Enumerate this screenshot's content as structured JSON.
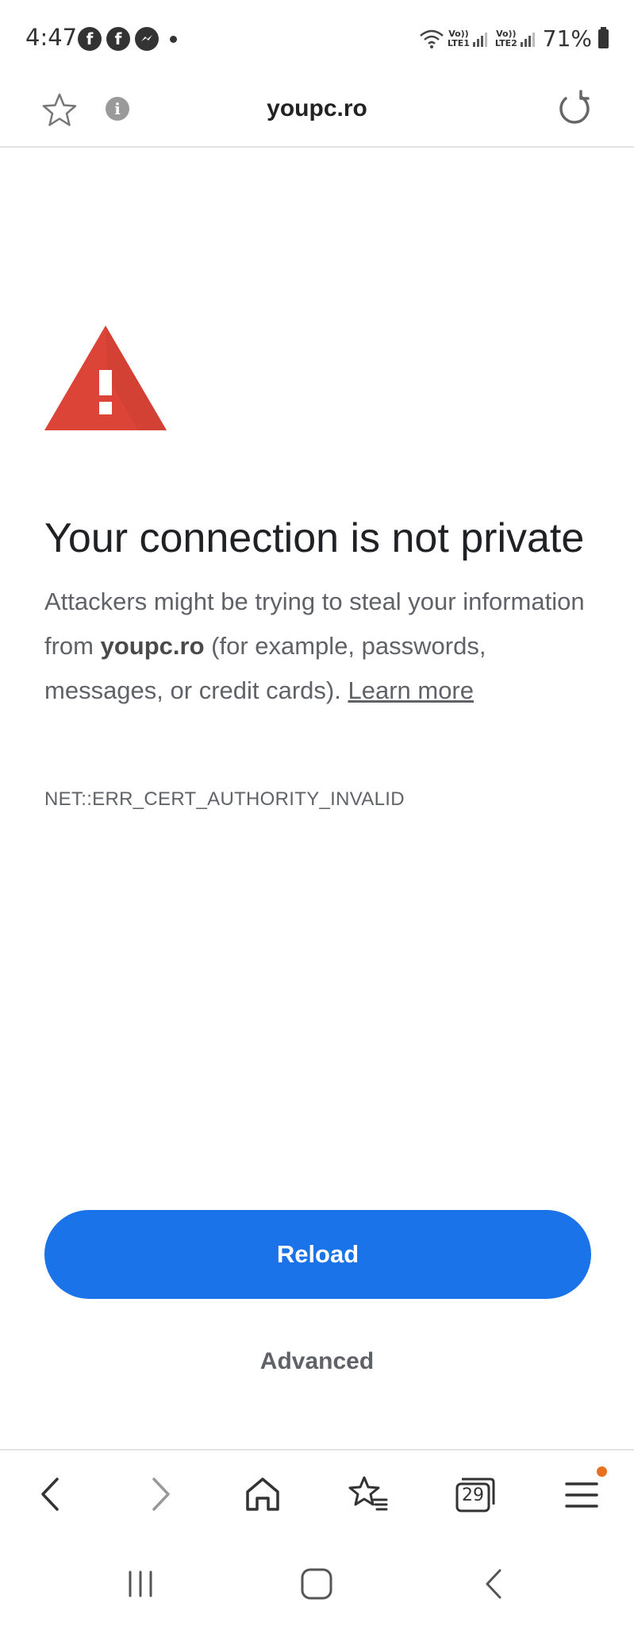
{
  "status_bar": {
    "time": "4:47",
    "app_icons": [
      "facebook-icon",
      "facebook-icon",
      "messenger-icon"
    ],
    "volte1": "Vo))\nLTE1",
    "volte2": "Vo))\nLTE2",
    "battery": "71%"
  },
  "url_bar": {
    "url": "youpc.ro"
  },
  "error_page": {
    "title": "Your connection is not private",
    "desc_prefix": "Attackers might be trying to steal your information from ",
    "desc_domain": "youpc.ro",
    "desc_suffix": " (for example, passwords, messages, or credit cards). ",
    "learn_more": "Learn more",
    "error_code": "NET::ERR_CERT_AUTHORITY_INVALID",
    "reload_label": "Reload",
    "advanced_label": "Advanced"
  },
  "bottom_bar": {
    "tab_count": "29"
  },
  "colors": {
    "accent": "#1a73e8",
    "warning": "#db4437",
    "notification": "#e8711f"
  }
}
